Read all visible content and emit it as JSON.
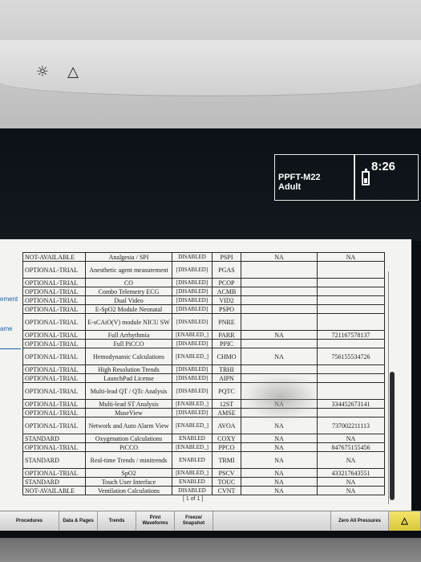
{
  "device": {
    "icons": [
      "alarm-pause-icon",
      "alarm-triangle-icon"
    ],
    "glyphs": {
      "alarm_pause": "☼",
      "alarm_triangle": "△"
    }
  },
  "header": {
    "profile": "PPFT-M22",
    "category": "Adult",
    "time": "8:26"
  },
  "side_labels": {
    "first": "ement",
    "second": "ame"
  },
  "options_table": [
    {
      "status": "NOT-AVAILABLE",
      "feature": "Analgesia / SPI",
      "license": "DISABLED",
      "code": "PSPI",
      "value1": "NA",
      "value2": "NA",
      "tall": false
    },
    {
      "status": "OPTIONAL-TRIAL",
      "feature": "Anesthetic agent measurement",
      "license": "[DISABLED]",
      "code": "PGAS",
      "value1": "",
      "value2": "",
      "tall": true
    },
    {
      "status": "OPTIONAL-TRIAL",
      "feature": "CO",
      "license": "[DISABLED]",
      "code": "PCOP",
      "value1": "",
      "value2": "",
      "tall": false
    },
    {
      "status": "OPTIONAL-TRIAL",
      "feature": "Combo Telemetry ECG",
      "license": "[DISABLED]",
      "code": "ACMB",
      "value1": "",
      "value2": "",
      "tall": false
    },
    {
      "status": "OPTIONAL-TRIAL",
      "feature": "Dual Video",
      "license": "[DISABLED]",
      "code": "VID2",
      "value1": "",
      "value2": "",
      "tall": false
    },
    {
      "status": "OPTIONAL-TRIAL",
      "feature": "E-SpO2 Module Neonatal",
      "license": "[DISABLED]",
      "code": "PSPO",
      "value1": "",
      "value2": "",
      "tall": false
    },
    {
      "status": "OPTIONAL-TRIAL",
      "feature": "E-sCAiO(V) module NICU SW",
      "license": "[DISABLED]",
      "code": "PNRE",
      "value1": "",
      "value2": "",
      "tall": true
    },
    {
      "status": "OPTIONAL-TRIAL",
      "feature": "Full Arrhythmia",
      "license": "[ENABLED_]",
      "code": "PARR",
      "value1": "NA",
      "value2": "721167578137",
      "tall": false
    },
    {
      "status": "OPTIONAL-TRIAL",
      "feature": "Full PiCCO",
      "license": "[DISABLED]",
      "code": "PPIC",
      "value1": "",
      "value2": "",
      "tall": false
    },
    {
      "status": "OPTIONAL-TRIAL",
      "feature": "Hemodynamic Calculations",
      "license": "[ENABLED_]",
      "code": "CHMO",
      "value1": "NA",
      "value2": "756155534726",
      "tall": true
    },
    {
      "status": "OPTIONAL-TRIAL",
      "feature": "High Resolution Trends",
      "license": "[DISABLED]",
      "code": "TRHI",
      "value1": "",
      "value2": "",
      "tall": false
    },
    {
      "status": "OPTIONAL-TRIAL",
      "feature": "LaunchPad License",
      "license": "[DISABLED]",
      "code": "AIPN",
      "value1": "",
      "value2": "",
      "tall": false
    },
    {
      "status": "OPTIONAL-TRIAL",
      "feature": "Multi-lead QT / QTc Analysis",
      "license": "[DISABLED]",
      "code": "PQTC",
      "value1": "",
      "value2": "",
      "tall": true
    },
    {
      "status": "OPTIONAL-TRIAL",
      "feature": "Multi-lead ST Analysis",
      "license": "[ENABLED_]",
      "code": "12ST",
      "value1": "NA",
      "value2": "334452673141",
      "tall": false
    },
    {
      "status": "OPTIONAL-TRIAL",
      "feature": "MuseView",
      "license": "[DISABLED]",
      "code": "AMSE",
      "value1": "",
      "value2": "",
      "tall": false
    },
    {
      "status": "OPTIONAL-TRIAL",
      "feature": "Network and Auto Alarm View",
      "license": "[ENABLED_]",
      "code": "AVOA",
      "value1": "NA",
      "value2": "737002211113",
      "tall": true
    },
    {
      "status": "STANDARD",
      "feature": "Oxygenation Calculations",
      "license": "ENABLED",
      "code": "COXY",
      "value1": "NA",
      "value2": "NA",
      "tall": false
    },
    {
      "status": "OPTIONAL-TRIAL",
      "feature": "PiCCO",
      "license": "[ENABLED_]",
      "code": "PPCO",
      "value1": "NA",
      "value2": "847675155456",
      "tall": false
    },
    {
      "status": "STANDARD",
      "feature": "Real-time Trends / minitrends",
      "license": "ENABLED",
      "code": "TRMI",
      "value1": "NA",
      "value2": "NA",
      "tall": true
    },
    {
      "status": "OPTIONAL-TRIAL",
      "feature": "SpO2",
      "license": "[ENABLED_]",
      "code": "PSCV",
      "value1": "NA",
      "value2": "433217643551",
      "tall": false
    },
    {
      "status": "STANDARD",
      "feature": "Touch User Interface",
      "license": "ENABLED",
      "code": "TOUC",
      "value1": "NA",
      "value2": "NA",
      "tall": false
    },
    {
      "status": "NOT-AVAILABLE",
      "feature": "Ventilation Calculations",
      "license": "DISABLED",
      "code": "CVNT",
      "value1": "NA",
      "value2": "NA",
      "tall": false
    }
  ],
  "page_footer": "[ 1 of 1 ]",
  "menu": [
    {
      "label": "Procedures",
      "name": "procedures-button",
      "width": 0
    },
    {
      "label": "Data & Pages",
      "name": "data-pages-button",
      "width": 0
    },
    {
      "label": "Trends",
      "name": "trends-button",
      "width": 0
    },
    {
      "label": "Print Waveforms",
      "name": "print-waveforms-button",
      "width": 0
    },
    {
      "label": "Freeze/ Snapshot",
      "name": "freeze-snapshot-button",
      "width": 0
    },
    {
      "label": "Zero All Pressures",
      "name": "zero-all-pressures-button",
      "width": 0
    }
  ],
  "colors": {
    "screen": "#0a0e12",
    "paper": "#f3f3f0",
    "alarm_button": "#e8d84e",
    "side_label": "#1a5fb4"
  }
}
